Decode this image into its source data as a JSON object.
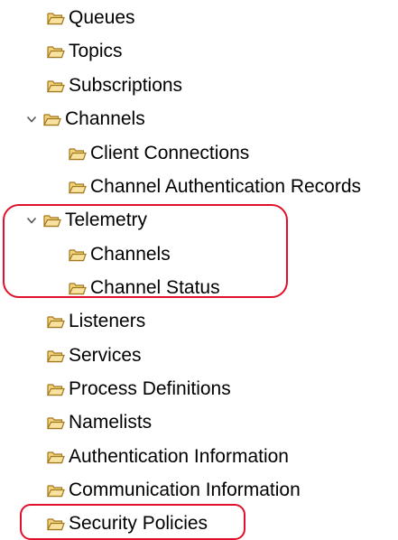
{
  "tree": {
    "items": [
      {
        "label": "Queues",
        "expandable": false
      },
      {
        "label": "Topics",
        "expandable": false
      },
      {
        "label": "Subscriptions",
        "expandable": false
      },
      {
        "label": "Channels",
        "expandable": true,
        "expanded": true
      },
      {
        "label": "Client Connections",
        "expandable": false
      },
      {
        "label": "Channel Authentication Records",
        "expandable": false
      },
      {
        "label": "Telemetry",
        "expandable": true,
        "expanded": true
      },
      {
        "label": "Channels",
        "expandable": false
      },
      {
        "label": "Channel Status",
        "expandable": false
      },
      {
        "label": "Listeners",
        "expandable": false
      },
      {
        "label": "Services",
        "expandable": false
      },
      {
        "label": "Process Definitions",
        "expandable": false
      },
      {
        "label": "Namelists",
        "expandable": false
      },
      {
        "label": "Authentication Information",
        "expandable": false
      },
      {
        "label": "Communication Information",
        "expandable": false
      },
      {
        "label": "Security Policies",
        "expandable": false
      }
    ]
  },
  "icons": {
    "folder": "open-folder-icon",
    "expand": "chevron-down-icon"
  },
  "colors": {
    "highlight": "#e0102a",
    "folder_body": "#f3d37a",
    "folder_outline": "#a0781e",
    "text": "#000000"
  }
}
